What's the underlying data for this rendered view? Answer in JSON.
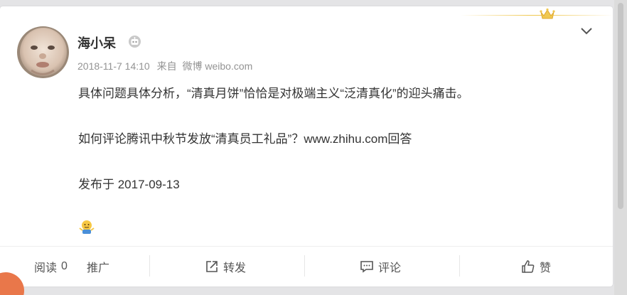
{
  "post": {
    "username": "海小呆",
    "timestamp": "2018-11-7 14:10",
    "source_prefix": "来自",
    "source": "微博 weibo.com",
    "lines": [
      "具体问题具体分析，“清真月饼”恰恰是对极端主义“泛清真化”的迎头痛击。",
      "如何评论腾讯中秋节发放“清真员工礼品”？www.zhihu.com回答",
      "发布于 2017-09-13"
    ]
  },
  "footer": {
    "reads_label": "阅读",
    "reads_count": "0",
    "promote_label": "推广",
    "repost_label": "转发",
    "comment_label": "评论",
    "like_label": "赞"
  },
  "icons": {
    "crown": "crown-icon",
    "robot": "robot-icon",
    "chevron": "chevron-down-icon",
    "repost": "share-icon",
    "comment": "comment-icon",
    "like": "thumbs-up-icon",
    "emoji": "shrug-emoji-icon"
  },
  "colors": {
    "crown": "#f0c850",
    "text": "#333333",
    "meta": "#939393",
    "accent_orange": "#e9774a"
  }
}
